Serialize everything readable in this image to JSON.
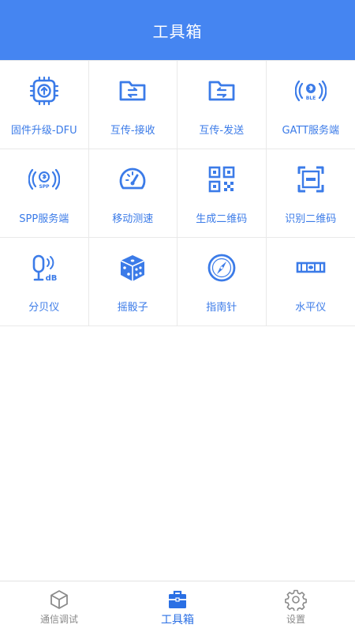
{
  "header": {
    "title": "工具箱"
  },
  "colors": {
    "primary": "#4585F1",
    "icon": "#3B7BE8",
    "inactive": "#8a8a8a"
  },
  "tools": [
    {
      "label": "固件升级-DFU",
      "icon": "chip-upload-icon"
    },
    {
      "label": "互传-接收",
      "icon": "folder-receive-icon"
    },
    {
      "label": "互传-发送",
      "icon": "folder-send-icon"
    },
    {
      "label": "GATT服务端",
      "icon": "ble-signal-icon"
    },
    {
      "label": "SPP服务端",
      "icon": "spp-signal-icon"
    },
    {
      "label": "移动测速",
      "icon": "speedometer-icon"
    },
    {
      "label": "生成二维码",
      "icon": "qr-code-icon"
    },
    {
      "label": "识别二维码",
      "icon": "qr-scan-icon"
    },
    {
      "label": "分贝仪",
      "icon": "microphone-db-icon"
    },
    {
      "label": "摇骰子",
      "icon": "dice-icon"
    },
    {
      "label": "指南针",
      "icon": "compass-icon"
    },
    {
      "label": "水平仪",
      "icon": "level-icon"
    }
  ],
  "bottom_nav": {
    "items": [
      {
        "label": "通信调试",
        "icon": "cube-icon"
      },
      {
        "label": "工具箱",
        "icon": "toolbox-icon",
        "active": true
      },
      {
        "label": "设置",
        "icon": "gear-icon"
      }
    ]
  }
}
